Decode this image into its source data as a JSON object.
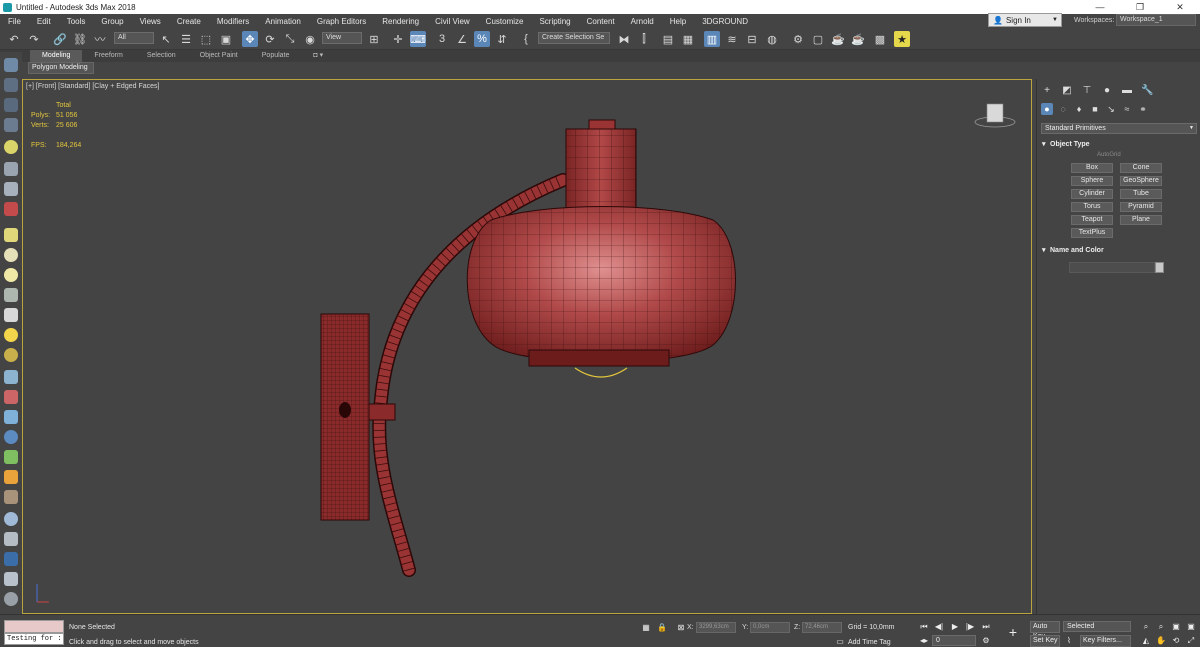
{
  "titlebar": {
    "title": "Untitled - Autodesk 3ds Max 2018",
    "minimize": "—",
    "maximize": "❐",
    "close": "✕"
  },
  "menu": [
    "File",
    "Edit",
    "Tools",
    "Group",
    "Views",
    "Create",
    "Modifiers",
    "Animation",
    "Graph Editors",
    "Rendering",
    "Civil View",
    "Customize",
    "Scripting",
    "Content",
    "Arnold",
    "Help",
    "3DGROUND"
  ],
  "account": {
    "sign_in": "Sign In",
    "workspaces_label": "Workspaces:",
    "workspace_value": "Workspace_1"
  },
  "toolbar": {
    "selection_filter": "All",
    "reference_coord": "View",
    "snap_label": "3",
    "named_selection": "Create Selection Se"
  },
  "ribbon": {
    "tabs": [
      "Modeling",
      "Freeform",
      "Selection",
      "Object Paint",
      "Populate"
    ],
    "sub_label": "Polygon Modeling"
  },
  "viewport": {
    "label": "[+] [Front] [Standard] [Clay + Edged Faces]",
    "stats": {
      "total_label": "Total",
      "polys_label": "Polys:",
      "polys_value": "51 056",
      "verts_label": "Verts:",
      "verts_value": "25 606",
      "fps_label": "FPS:",
      "fps_value": "184,264"
    }
  },
  "command_panel": {
    "category": "Standard Primitives",
    "object_type_title": "Object Type",
    "autogrid": "AutoGrid",
    "buttons": [
      "Box",
      "Cone",
      "Sphere",
      "GeoSphere",
      "Cylinder",
      "Tube",
      "Torus",
      "Pyramid",
      "Teapot",
      "Plane",
      "TextPlus"
    ],
    "name_color_title": "Name and Color"
  },
  "statusbar": {
    "maxscript": "Testing for :",
    "selection_status": "None Selected",
    "prompt": "Click and drag to select and move objects",
    "x_label": "X:",
    "x_value": "3299,63cm",
    "y_label": "Y:",
    "y_value": "0,0cm",
    "z_label": "Z:",
    "z_value": "72,46cm",
    "grid": "Grid = 10,0mm",
    "add_time_tag": "Add Time Tag",
    "auto_key": "Auto Key",
    "set_key": "Set Key",
    "key_mode": "Selected",
    "key_filters": "Key Filters...",
    "frame": "0"
  }
}
